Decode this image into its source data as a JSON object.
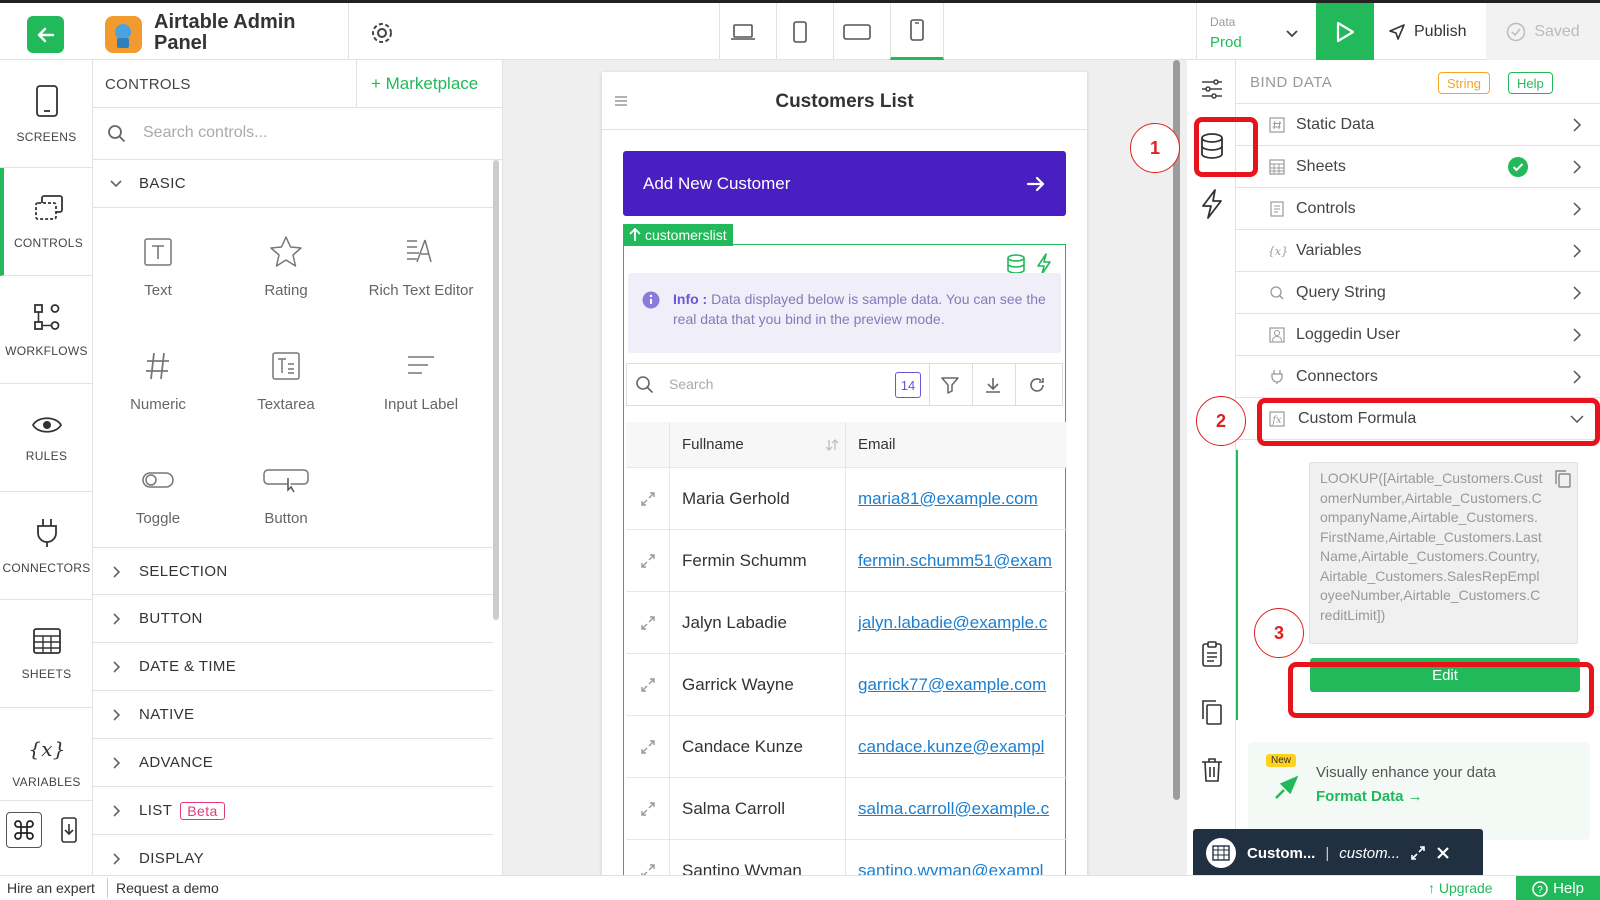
{
  "app": {
    "title": "Airtable Admin Panel",
    "data_label": "Data",
    "data_env": "Prod",
    "publish": "Publish",
    "saved": "Saved"
  },
  "nav": [
    {
      "label": "SCREENS",
      "icon": "mobile-icon"
    },
    {
      "label": "CONTROLS",
      "icon": "controls-icon"
    },
    {
      "label": "WORKFLOWS",
      "icon": "workflow-icon"
    },
    {
      "label": "RULES",
      "icon": "eye-icon"
    },
    {
      "label": "CONNECTORS",
      "icon": "plug-icon"
    },
    {
      "label": "SHEETS",
      "icon": "table-icon"
    },
    {
      "label": "VARIABLES",
      "icon": "variable-icon"
    }
  ],
  "controls": {
    "title": "CONTROLS",
    "marketplace": "+ Marketplace",
    "search_placeholder": "Search controls...",
    "basic": "BASIC",
    "tiles": [
      "Text",
      "Rating",
      "Rich Text Editor",
      "Numeric",
      "Textarea",
      "Input Label",
      "Toggle",
      "Button"
    ],
    "sections": [
      "SELECTION",
      "BUTTON",
      "DATE & TIME",
      "NATIVE",
      "ADVANCE",
      "LIST",
      "DISPLAY"
    ],
    "beta": "Beta"
  },
  "screen": {
    "title": "Customers List",
    "add_button": "Add New Customer",
    "tag": "customerslist",
    "info_prefix": "Info :",
    "info_text": " Data displayed below is sample data. You can see the real data that you bind in the preview mode.",
    "search_placeholder": "Search",
    "count": "14",
    "columns": [
      "Fullname",
      "Email"
    ],
    "rows": [
      {
        "name": "Maria Gerhold",
        "email": "maria81@example.com"
      },
      {
        "name": "Fermin Schumm",
        "email": "fermin.schumm51@exam"
      },
      {
        "name": "Jalyn Labadie",
        "email": "jalyn.labadie@example.c"
      },
      {
        "name": "Garrick Wayne",
        "email": "garrick77@example.com"
      },
      {
        "name": "Candace Kunze",
        "email": "candace.kunze@exampl"
      },
      {
        "name": "Salma Carroll",
        "email": "salma.carroll@example.c"
      },
      {
        "name": "Santino Wyman",
        "email": "santino.wyman@exampl"
      }
    ]
  },
  "bind": {
    "title": "BIND DATA",
    "type_pill": "String",
    "help_pill": "Help",
    "items": [
      "Static Data",
      "Sheets",
      "Controls",
      "Variables",
      "Query String",
      "Loggedin User",
      "Connectors",
      "Custom Formula"
    ],
    "formula": "LOOKUP([Airtable_Customers.CustomerNumber,Airtable_Customers.CompanyName,Airtable_Customers.FirstName,Airtable_Customers.LastName,Airtable_Customers.Country,Airtable_Customers.SalesRepEmployeeNumber,Airtable_Customers.CreditLimit])",
    "edit": "Edit",
    "promo_badge": "New",
    "promo_text": "Visually enhance your data",
    "promo_link": "Format Data →"
  },
  "annotations": [
    "1",
    "2",
    "3"
  ],
  "toast": {
    "title": "Custom...",
    "sub": "custom..."
  },
  "footer": {
    "hire": "Hire an expert",
    "demo": "Request a demo",
    "upgrade": "↑ Upgrade",
    "help": "Help"
  },
  "colors": {
    "accent": "#22b95a",
    "button_purple": "#4a1fc1",
    "annotation_red": "#e8141c",
    "link_blue": "#1a7fd1"
  }
}
